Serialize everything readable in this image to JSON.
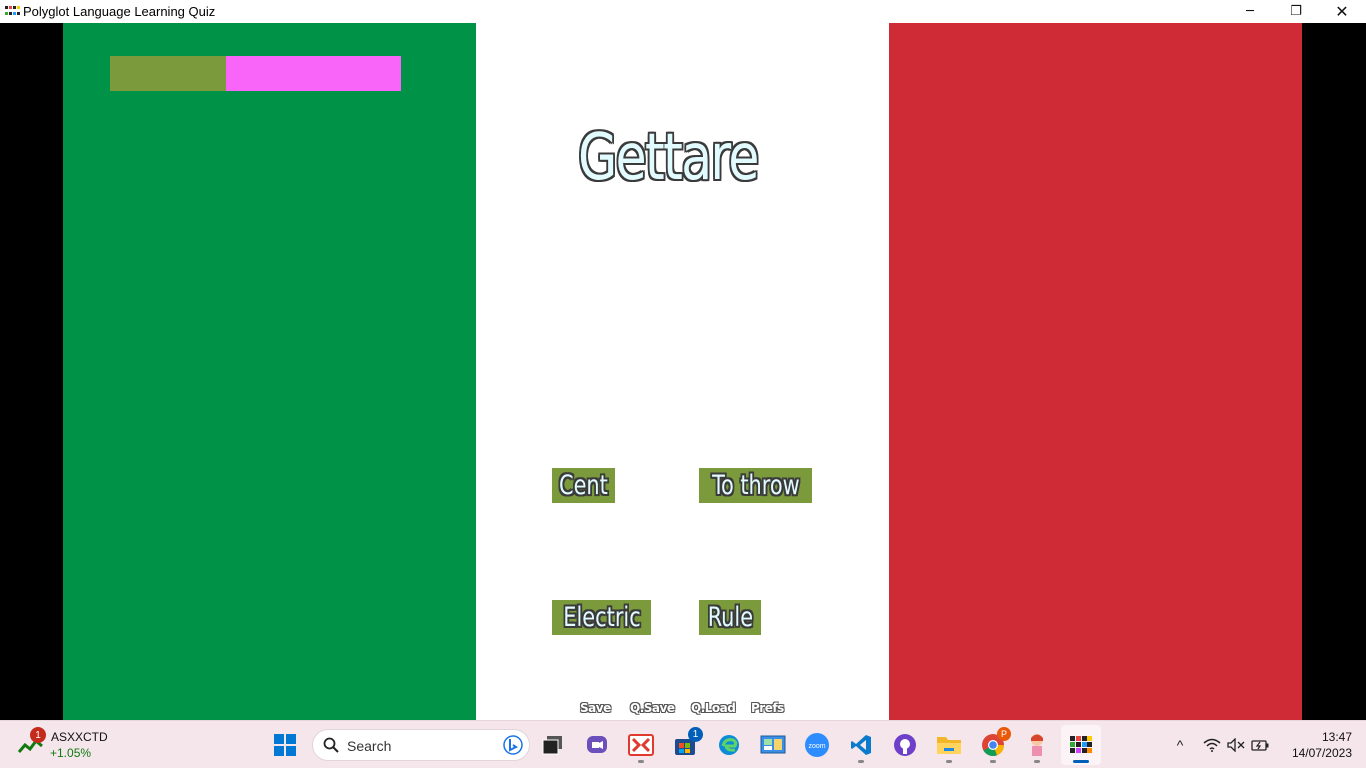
{
  "window": {
    "title": "Polyglot Language Learning Quiz",
    "controls": {
      "minimize": "─",
      "maximize": "❐",
      "close": "✕"
    }
  },
  "quiz": {
    "flag_colors": {
      "green": "#009246",
      "white": "#ffffff",
      "red": "#ce2b37"
    },
    "progress": {
      "fraction": 0.4,
      "fill_color": "#7b9a3c",
      "track_color": "#f865f8"
    },
    "word": "Gettare",
    "answers": [
      "Cent",
      "To throw",
      "Electric",
      "Rule"
    ],
    "answer_bg": "#7b9a3c",
    "quick_menu": [
      "Save",
      "Q.Save",
      "Q.Load",
      "Prefs"
    ]
  },
  "taskbar": {
    "widget": {
      "badge": "1",
      "name": "ASXXCTD",
      "change": "+1.05%"
    },
    "search_placeholder": "Search",
    "apps": [
      {
        "name": "start-icon"
      },
      {
        "name": "task-view-icon"
      },
      {
        "name": "meet-icon"
      },
      {
        "name": "dc-app-icon"
      },
      {
        "name": "store-icon",
        "badge": "1"
      },
      {
        "name": "edge-icon"
      },
      {
        "name": "control-panel-icon"
      },
      {
        "name": "zoom-icon",
        "label": "zoom"
      },
      {
        "name": "vscode-icon"
      },
      {
        "name": "github-icon"
      },
      {
        "name": "file-explorer-icon"
      },
      {
        "name": "chrome-icon",
        "badge": "P"
      },
      {
        "name": "renpy-icon"
      },
      {
        "name": "polyglot-icon"
      }
    ],
    "tray": {
      "chevron": "^",
      "clock": {
        "time": "13:47",
        "date": "14/07/2023"
      }
    }
  }
}
